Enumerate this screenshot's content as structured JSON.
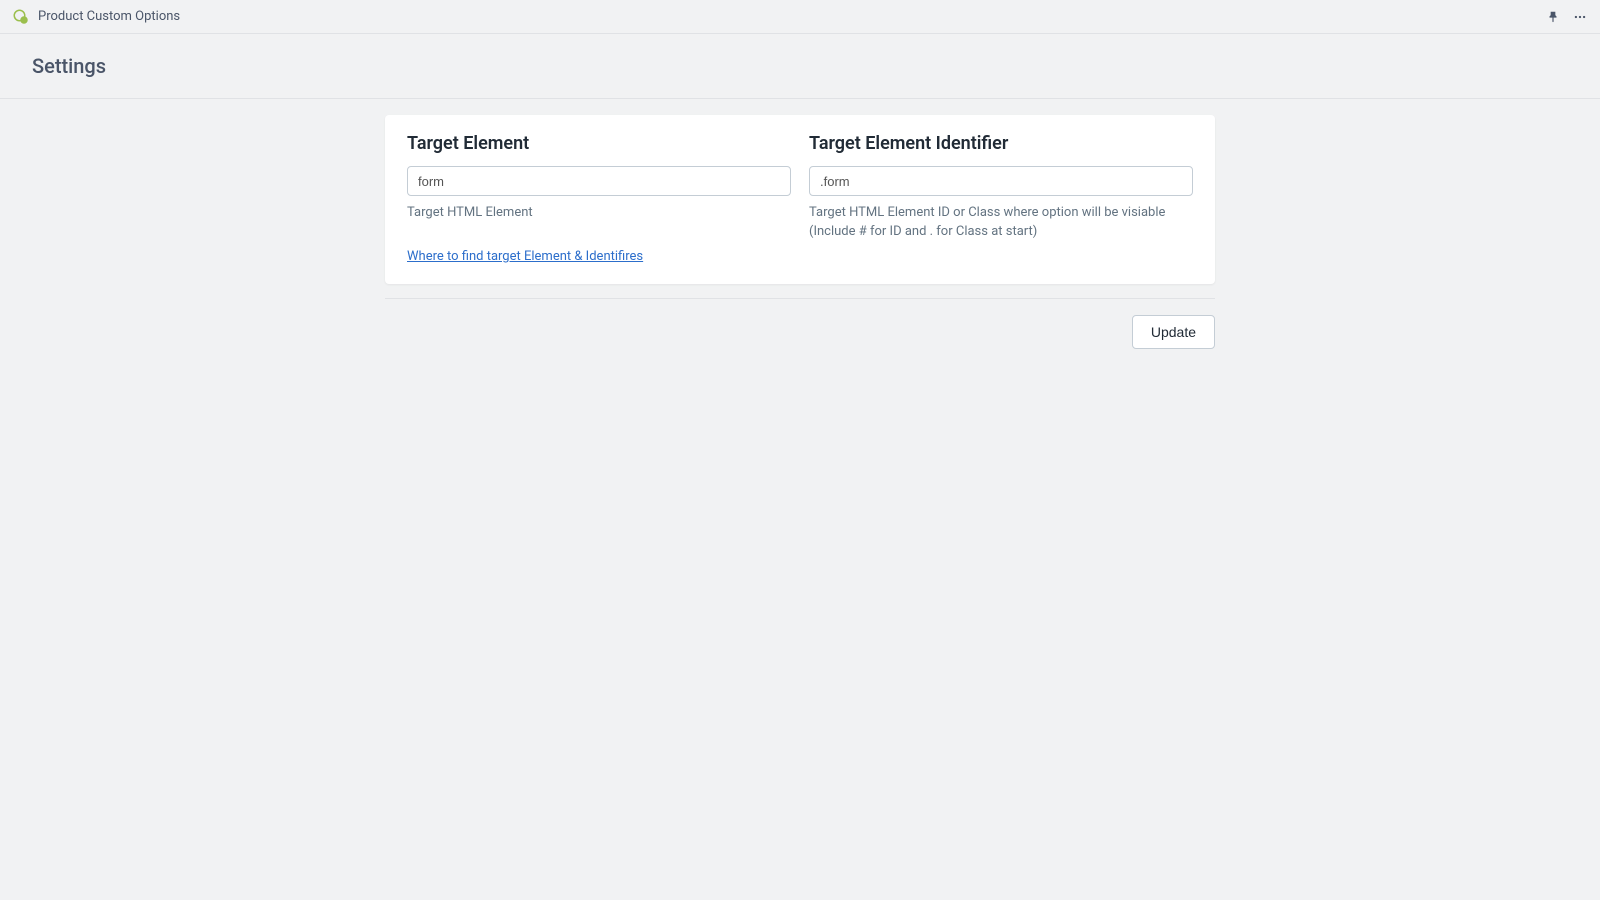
{
  "topbar": {
    "app_title": "Product Custom Options"
  },
  "header": {
    "title": "Settings"
  },
  "card": {
    "left": {
      "title": "Target Element",
      "input_value": "form",
      "help": "Target HTML Element"
    },
    "right": {
      "title": "Target Element Identifier",
      "input_value": ".form",
      "help": "Target HTML Element ID or Class where option will be visiable (Include # for ID and . for Class at start)"
    },
    "help_link": "Where to find target Element & Identifires"
  },
  "actions": {
    "update_label": "Update"
  }
}
